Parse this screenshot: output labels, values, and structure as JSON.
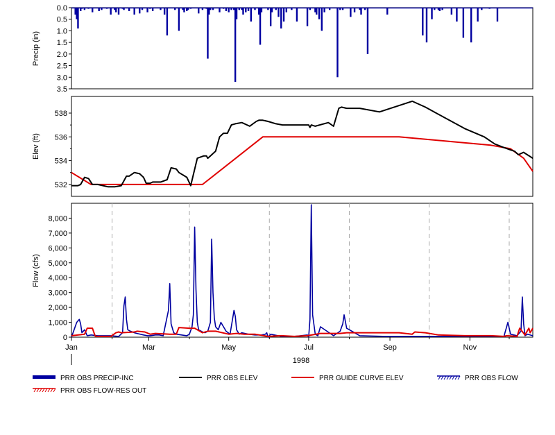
{
  "chart_data": [
    {
      "type": "bar",
      "name": "precipitation",
      "ylabel": "Precip (in)",
      "ylim": [
        0,
        3.5
      ],
      "y_inverted": true,
      "yticks": [
        "0.0",
        "0.5",
        "1.0",
        "1.5",
        "2.0",
        "2.5",
        "3.0",
        "3.5"
      ],
      "series": [
        {
          "name": "PRR OBS PRECIP-INC",
          "color": "#0000a0",
          "days": [
            3,
            4,
            5,
            7,
            8,
            10,
            13,
            16,
            21,
            23,
            27,
            30,
            33,
            34,
            36,
            39,
            40,
            44,
            48,
            52,
            54,
            58,
            60,
            62,
            68,
            71,
            73,
            79,
            82,
            85,
            86,
            88,
            89,
            91,
            97,
            100,
            103,
            104,
            105,
            106,
            108,
            113,
            116,
            118,
            120,
            122,
            124,
            125,
            126,
            128,
            130,
            131,
            133,
            135,
            137,
            140,
            143,
            144,
            145,
            150,
            152,
            153,
            156,
            158,
            160,
            162,
            164,
            168,
            172,
            180,
            182,
            186,
            187,
            189,
            191,
            193,
            197,
            203,
            205,
            207,
            213,
            216,
            220,
            221,
            224,
            226,
            241,
            268,
            271,
            275,
            277,
            280,
            281,
            283,
            290,
            294,
            299,
            305,
            310,
            313,
            319,
            325
          ],
          "values": [
            0.3,
            0.5,
            0.9,
            0.15,
            0.05,
            0.1,
            0.05,
            0.2,
            0.15,
            0.1,
            0.05,
            0.3,
            0.1,
            0.2,
            0.3,
            0.05,
            0.1,
            0.15,
            0.3,
            0.25,
            0.1,
            0.2,
            0.05,
            0.15,
            0.1,
            0.3,
            1.2,
            0.1,
            1.0,
            0.1,
            0.2,
            0.15,
            0.1,
            0.05,
            0.25,
            0.1,
            0.05,
            2.2,
            0.3,
            0.1,
            0.1,
            0.2,
            0.05,
            0.15,
            0.2,
            0.1,
            0.1,
            3.2,
            0.5,
            0.1,
            0.1,
            0.3,
            0.2,
            0.15,
            0.6,
            0.1,
            0.3,
            1.6,
            0.2,
            0.1,
            0.8,
            0.2,
            0.1,
            0.4,
            0.9,
            0.6,
            0.2,
            0.1,
            0.6,
            0.8,
            0.1,
            0.2,
            0.3,
            0.5,
            1.0,
            0.2,
            0.1,
            3.0,
            0.1,
            0.1,
            0.4,
            0.2,
            0.1,
            0.3,
            0.1,
            2.0,
            0.3,
            1.2,
            1.5,
            0.5,
            0.1,
            0.1,
            0.15,
            0.1,
            0.3,
            0.6,
            1.3,
            1.5,
            0.6,
            0.1,
            0.05,
            0.6,
            0.1,
            0.6
          ]
        }
      ]
    },
    {
      "type": "line",
      "name": "elevation",
      "ylabel": "Elev (ft)",
      "ylim": [
        531,
        539.4
      ],
      "yticks": [
        532,
        534,
        536,
        538
      ],
      "series": [
        {
          "name": "PRR OBS ELEV",
          "color": "#000000",
          "x": [
            0,
            5,
            7,
            10,
            13,
            16,
            20,
            28,
            33,
            38,
            42,
            44,
            48,
            52,
            55,
            57,
            60,
            62,
            68,
            73,
            76,
            80,
            82,
            85,
            88,
            91,
            96,
            101,
            103,
            104,
            106,
            110,
            113,
            116,
            119,
            122,
            125,
            130,
            136,
            141,
            143,
            146,
            150,
            156,
            161,
            166,
            171,
            176,
            181,
            182,
            183,
            186,
            196,
            200,
            204,
            206,
            210,
            214,
            220,
            235,
            260,
            270,
            280,
            300,
            315,
            323,
            330,
            335,
            338,
            341,
            345,
            352
          ],
          "y": [
            531.9,
            531.9,
            532.0,
            532.6,
            532.5,
            532.0,
            532.0,
            531.8,
            531.8,
            531.9,
            532.7,
            532.7,
            533.0,
            532.9,
            532.6,
            532.1,
            532.1,
            532.2,
            532.2,
            532.4,
            533.4,
            533.3,
            533.0,
            532.8,
            532.6,
            531.9,
            534.2,
            534.4,
            534.4,
            534.2,
            534.4,
            534.8,
            536.0,
            536.3,
            536.3,
            537.0,
            537.1,
            537.2,
            536.9,
            537.3,
            537.4,
            537.4,
            537.3,
            537.1,
            537.0,
            537.0,
            537.0,
            537.0,
            537.0,
            536.8,
            537.0,
            536.9,
            537.2,
            536.9,
            538.4,
            538.5,
            538.4,
            538.4,
            538.4,
            538.1,
            539.0,
            538.5,
            537.9,
            536.7,
            536.0,
            535.4,
            535.1,
            534.9,
            534.8,
            534.5,
            534.7,
            534.2
          ]
        },
        {
          "name": "PRR GUIDE CURVE ELEV",
          "color": "#e00000",
          "x": [
            0,
            15,
            100,
            146,
            250,
            290,
            320,
            335,
            345,
            352
          ],
          "y": [
            533.0,
            532.0,
            532.0,
            536.0,
            536.0,
            535.6,
            535.3,
            535.0,
            534.2,
            533.1
          ]
        }
      ]
    },
    {
      "type": "line",
      "name": "flow",
      "ylabel": "Flow (cfs)",
      "ylim": [
        0,
        9000
      ],
      "yticks": [
        "0",
        "1,000",
        "2,000",
        "3,000",
        "4,000",
        "5,000",
        "6,000",
        "7,000",
        "8,000"
      ],
      "xlabel": "1998",
      "xticks": [
        "Jan",
        "Mar",
        "May",
        "Jul",
        "Sep",
        "Nov"
      ],
      "series": [
        {
          "name": "PRR OBS FLOW",
          "color": "#0000a0",
          "x": [
            0,
            2,
            4,
            6,
            7,
            8,
            10,
            12,
            15,
            20,
            30,
            36,
            39,
            40,
            41,
            42,
            43,
            45,
            48,
            50,
            55,
            58,
            60,
            64,
            67,
            70,
            74,
            75,
            76,
            78,
            80,
            84,
            88,
            90,
            92,
            93,
            94,
            95,
            96,
            97,
            100,
            102,
            104,
            106,
            107,
            108,
            109,
            110,
            112,
            114,
            118,
            121,
            124,
            125,
            126,
            128,
            130,
            135,
            140,
            145,
            148,
            149,
            150,
            152,
            160,
            170,
            175,
            180,
            181,
            182,
            183,
            184,
            186,
            188,
            190,
            200,
            205,
            207,
            208,
            210,
            220,
            240,
            260,
            280,
            300,
            330,
            333,
            335,
            340,
            343,
            344,
            345,
            346,
            348,
            352
          ],
          "y": [
            0,
            500,
            1000,
            1200,
            900,
            300,
            500,
            100,
            150,
            100,
            100,
            50,
            300,
            2100,
            2700,
            1200,
            500,
            400,
            300,
            250,
            150,
            100,
            100,
            150,
            150,
            100,
            1800,
            3600,
            900,
            300,
            200,
            150,
            100,
            200,
            700,
            1500,
            7400,
            3200,
            1000,
            500,
            350,
            300,
            400,
            1000,
            6600,
            3000,
            1300,
            700,
            500,
            1000,
            400,
            200,
            1800,
            1400,
            500,
            200,
            300,
            200,
            150,
            150,
            200,
            300,
            0,
            200,
            50,
            50,
            100,
            150,
            0,
            1200,
            8900,
            1500,
            200,
            100,
            700,
            100,
            400,
            900,
            1500,
            600,
            100,
            50,
            50,
            50,
            50,
            50,
            1000,
            200,
            100,
            400,
            2700,
            900,
            100,
            200,
            100
          ]
        },
        {
          "name": "PRR OBS FLOW-RES OUT",
          "color": "#e00000",
          "x": [
            0,
            10,
            12,
            16,
            18,
            19,
            30,
            34,
            36,
            38,
            48,
            50,
            56,
            60,
            64,
            75,
            80,
            82,
            90,
            94,
            100,
            104,
            110,
            120,
            126,
            132,
            140,
            150,
            160,
            170,
            180,
            190,
            200,
            205,
            210,
            250,
            260,
            262,
            270,
            280,
            300,
            320,
            330,
            332,
            340,
            342,
            346,
            349,
            350,
            352
          ],
          "y": [
            100,
            200,
            600,
            600,
            100,
            50,
            50,
            300,
            350,
            300,
            350,
            400,
            350,
            200,
            250,
            200,
            200,
            650,
            600,
            600,
            300,
            400,
            400,
            200,
            250,
            200,
            200,
            50,
            100,
            50,
            100,
            250,
            250,
            250,
            300,
            300,
            200,
            350,
            300,
            150,
            100,
            100,
            50,
            100,
            50,
            600,
            150,
            600,
            300,
            600
          ]
        }
      ]
    }
  ],
  "legend": [
    {
      "label": "PRR OBS PRECIP-INC",
      "color": "#0000a0",
      "style": "bar"
    },
    {
      "label": "PRR OBS ELEV",
      "color": "#000000",
      "style": "line"
    },
    {
      "label": "PRR GUIDE CURVE ELEV",
      "color": "#e00000",
      "style": "line"
    },
    {
      "label": "PRR OBS FLOW",
      "color": "#0000a0",
      "style": "hatched"
    },
    {
      "label": "PRR OBS FLOW-RES OUT",
      "color": "#e00000",
      "style": "hatched"
    }
  ]
}
